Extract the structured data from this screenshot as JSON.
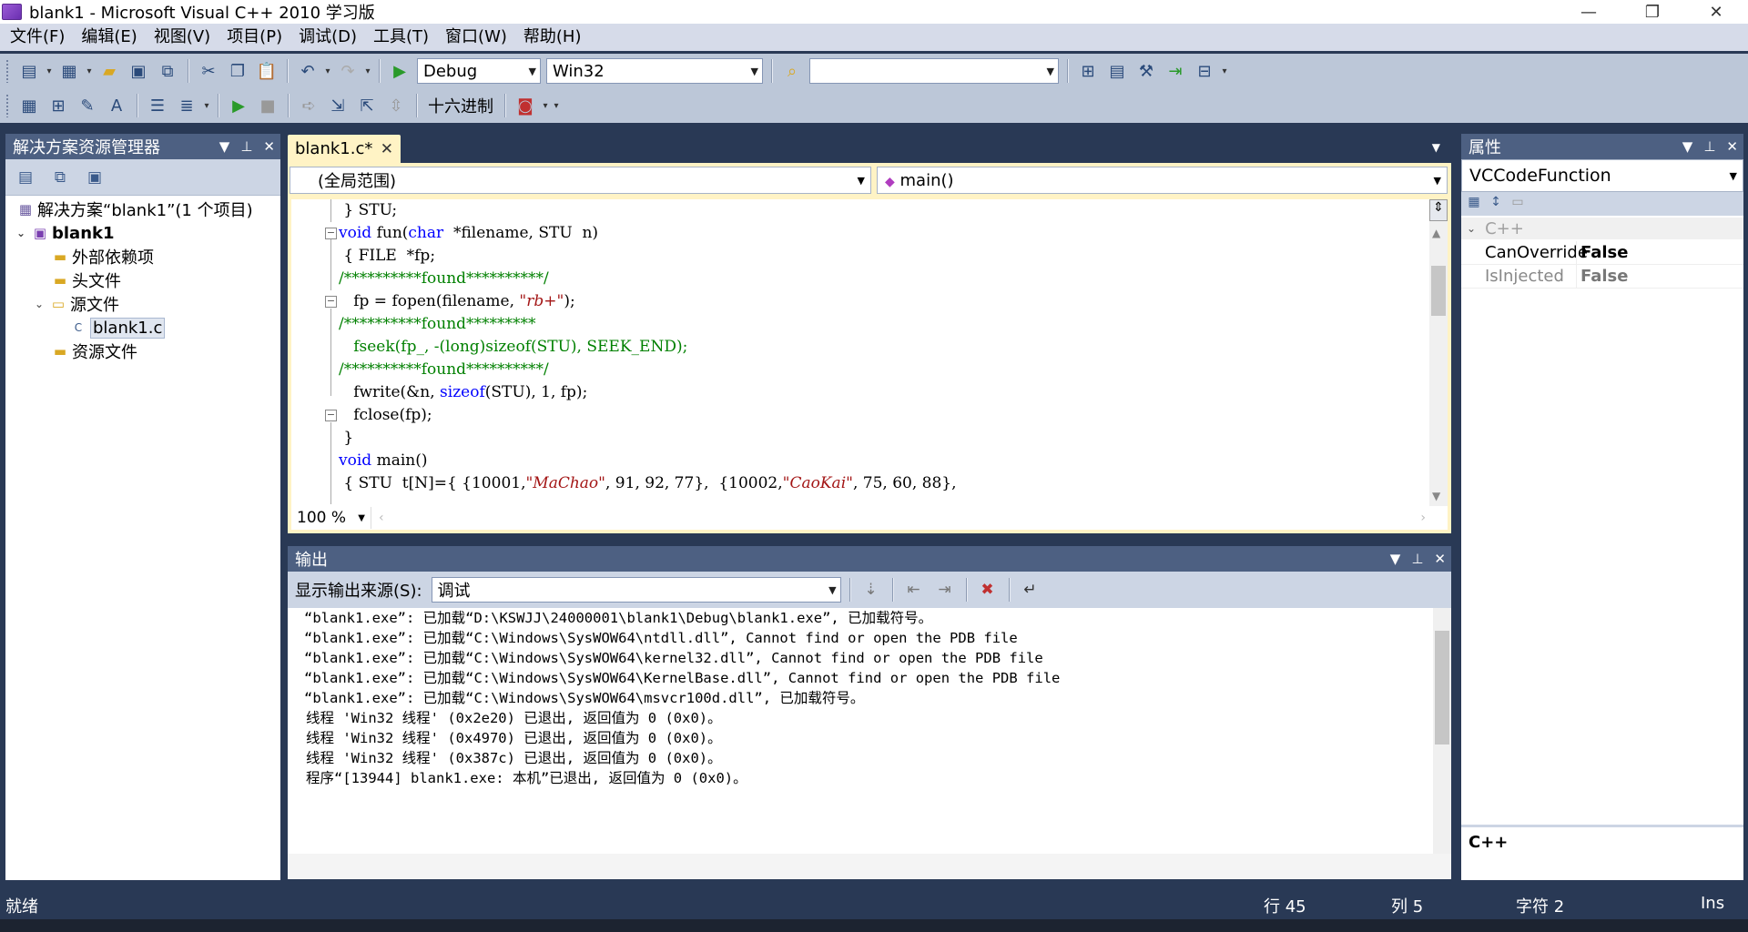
{
  "window": {
    "title": "blank1 - Microsoft Visual C++ 2010 学习版",
    "controls": {
      "minimize": "—",
      "maximize": "❐",
      "close": "✕"
    }
  },
  "menu": [
    "文件(F)",
    "编辑(E)",
    "视图(V)",
    "项目(P)",
    "调试(D)",
    "工具(T)",
    "窗口(W)",
    "帮助(H)"
  ],
  "toolbar": {
    "config": "Debug",
    "platform": "Win32",
    "find_value": "",
    "hex_label": "十六进制"
  },
  "solution_explorer": {
    "title": "解决方案资源管理器",
    "items": [
      {
        "label": "解决方案“blank1”(1 个项目)",
        "icon": "solution-icon"
      },
      {
        "label": "blank1",
        "icon": "project-icon"
      },
      {
        "label": "外部依赖项",
        "icon": "folder-icon"
      },
      {
        "label": "头文件",
        "icon": "folder-icon"
      },
      {
        "label": "源文件",
        "icon": "folder-icon"
      },
      {
        "label": "blank1.c",
        "icon": "c-file-icon"
      },
      {
        "label": "资源文件",
        "icon": "folder-icon"
      }
    ]
  },
  "editor": {
    "tab": "blank1.c*",
    "scope": "(全局范围)",
    "function": "main()",
    "zoom": "100 %",
    "lines": [
      " } STU;",
      "void fun(char  *filename, STU  n)",
      " { FILE  *fp;",
      "/**********found**********/",
      "   fp = fopen(filename, \"rb+\");",
      "/**********found*********",
      "   fseek(fp_, -(long)sizeof(STU), SEEK_END);",
      "/**********found**********/",
      "   fwrite(&n, sizeof(STU), 1, fp);",
      "   fclose(fp);",
      " }",
      "void main()",
      " { STU  t[N]={ {10001,\"MaChao\", 91, 92, 77},  {10002,\"CaoKai\", 75, 60, 88},"
    ]
  },
  "output": {
    "title": "输出",
    "source_label": "显示输出来源(S):",
    "source_value": "调试",
    "lines": [
      "“blank1.exe”: 已加载“D:\\KSWJJ\\24000001\\blank1\\Debug\\blank1.exe”, 已加载符号。",
      "“blank1.exe”: 已加载“C:\\Windows\\SysWOW64\\ntdll.dll”, Cannot find or open the PDB file",
      "“blank1.exe”: 已加载“C:\\Windows\\SysWOW64\\kernel32.dll”, Cannot find or open the PDB file",
      "“blank1.exe”: 已加载“C:\\Windows\\SysWOW64\\KernelBase.dll”, Cannot find or open the PDB file",
      "“blank1.exe”: 已加载“C:\\Windows\\SysWOW64\\msvcr100d.dll”, 已加载符号。",
      "线程 'Win32 线程' (0x2e20) 已退出, 返回值为 0 (0x0)。",
      "线程 'Win32 线程' (0x4970) 已退出, 返回值为 0 (0x0)。",
      "线程 'Win32 线程' (0x387c) 已退出, 返回值为 0 (0x0)。",
      "程序“[13944] blank1.exe: 本机”已退出, 返回值为 0 (0x0)。"
    ]
  },
  "properties": {
    "title": "属性",
    "object": "VCCodeFunction",
    "category": "C++",
    "rows": [
      {
        "name": "CanOverride",
        "value": "False"
      },
      {
        "name": "IsInjected",
        "value": "False"
      }
    ],
    "description": "C++"
  },
  "status": {
    "ready": "就绪",
    "line": "行 45",
    "col": "列 5",
    "char": "字符 2",
    "mode": "Ins"
  }
}
